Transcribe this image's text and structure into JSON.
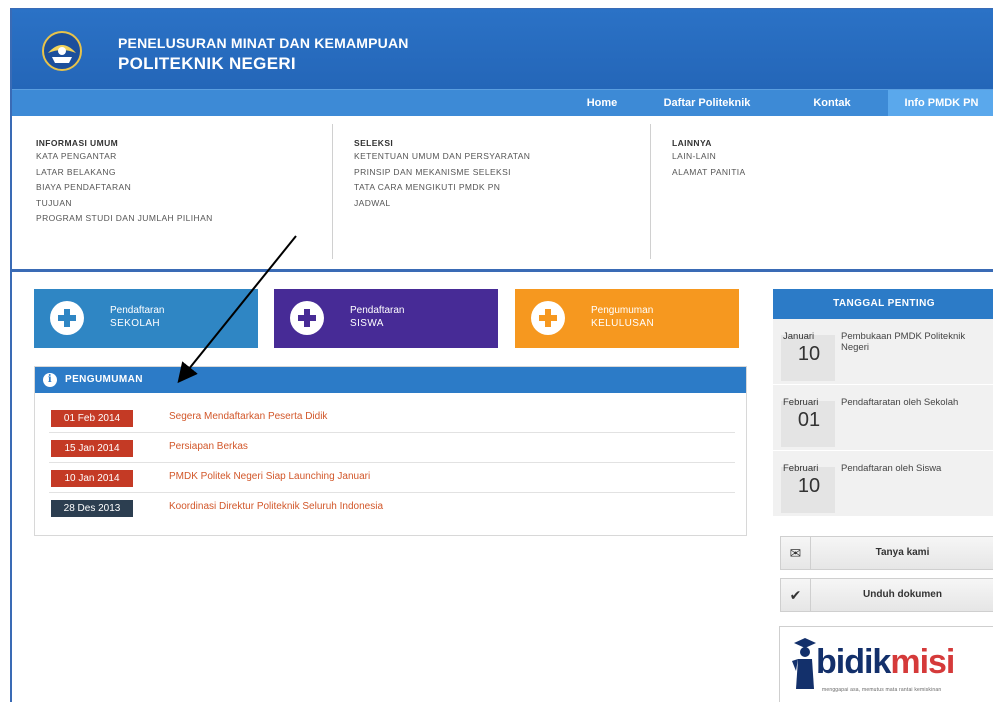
{
  "header": {
    "title_line1": "PENELUSURAN MINAT DAN KEMAMPUAN",
    "title_line2": "POLITEKNIK NEGERI"
  },
  "nav": [
    {
      "label": "Home"
    },
    {
      "label": "Daftar Politeknik"
    },
    {
      "label": "Kontak"
    },
    {
      "label": "Info PMDK PN"
    }
  ],
  "menu": {
    "informasi": {
      "heading": "INFORMASI UMUM",
      "links": [
        "KATA PENGANTAR",
        "LATAR BELAKANG",
        "BIAYA PENDAFTARAN",
        "TUJUAN",
        "PROGRAM STUDI DAN JUMLAH PILIHAN"
      ]
    },
    "seleksi": {
      "heading": "SELEKSI",
      "links": [
        "KETENTUAN UMUM DAN PERSYARATAN",
        "PRINSIP DAN MEKANISME SELEKSI",
        "TATA CARA MENGIKUTI PMDK PN",
        "JADWAL"
      ]
    },
    "lainnya": {
      "heading": "LAINNYA",
      "links": [
        "LAIN-LAIN",
        "ALAMAT PANITIA"
      ]
    }
  },
  "big_buttons": [
    {
      "line1": "Pendaftaran",
      "line2": "SEKOLAH",
      "color": "#2f86c4"
    },
    {
      "line1": "Pendaftaran",
      "line2": "SISWA",
      "color": "#472b96"
    },
    {
      "line1": "Pengumuman",
      "line2": "KELULUSAN",
      "color": "#f6981f"
    }
  ],
  "announcements": {
    "heading": "PENGUMUMAN",
    "items": [
      {
        "date": "01 Feb 2014",
        "title": "Segera Mendaftarkan Peserta Didik",
        "badge_color": "#c43a25"
      },
      {
        "date": "15 Jan 2014",
        "title": "Persiapan Berkas",
        "badge_color": "#c43a25"
      },
      {
        "date": "10 Jan 2014",
        "title": "PMDK Politek Negeri Siap Launching Januari",
        "badge_color": "#c43a25"
      },
      {
        "date": "28 Des 2013",
        "title": "Koordinasi Direktur Politeknik Seluruh Indonesia",
        "badge_color": "#2c3e50"
      }
    ]
  },
  "sidebar": {
    "heading": "TANGGAL PENTING",
    "events": [
      {
        "month": "Januari",
        "day": "10",
        "desc": "Pembukaan PMDK Politeknik Negeri"
      },
      {
        "month": "Februari",
        "day": "01",
        "desc": "Pendaftaratan oleh Sekolah"
      },
      {
        "month": "Februari",
        "day": "10",
        "desc": "Pendaftaran oleh Siswa"
      }
    ],
    "buttons": [
      {
        "label": "Tanya kami",
        "icon": "chat-icon"
      },
      {
        "label": "Unduh dokumen",
        "icon": "check-icon"
      }
    ],
    "banner": {
      "word_a": "bidik",
      "word_b": "misi",
      "tagline": "menggapai asa, memutus mata rantai kemiskinan"
    }
  }
}
